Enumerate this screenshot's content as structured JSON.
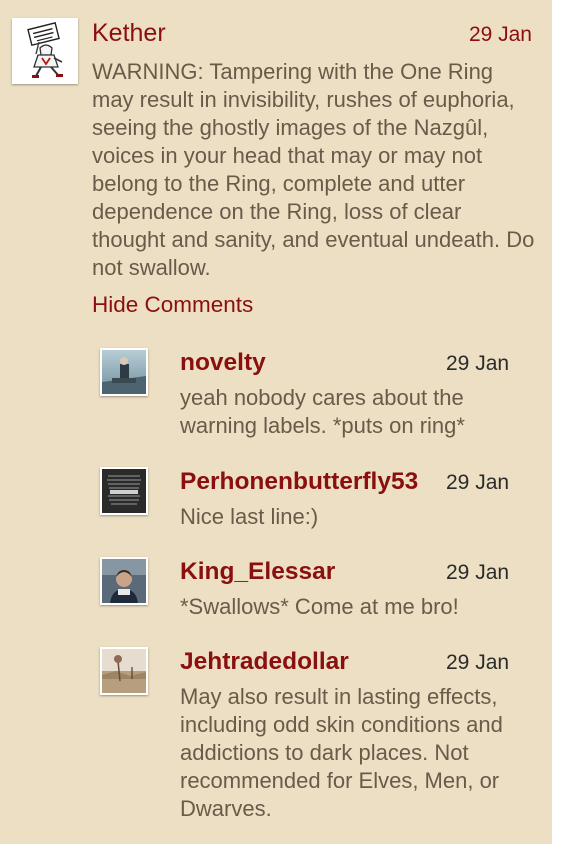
{
  "post": {
    "author": "Kether",
    "date": "29 Jan",
    "body": "WARNING: Tampering with the One Ring may result in invisibility, rushes of euphoria, seeing the ghostly images of the Nazgûl, voices in your head that may or may not belong to the Ring, complete and utter dependence on the Ring, loss of clear thought and sanity, and eventual undeath. Do not swallow.",
    "avatar_icon": "assassin-cartoon-avatar-icon",
    "hide_comments_label": "Hide Comments"
  },
  "replies": [
    {
      "author": "novelty",
      "date": "29 Jan",
      "body": "yeah nobody cares about the warning labels. *puts on ring*",
      "avatar_icon": "photo-avatar-icon"
    },
    {
      "author": "Perhonenbutterfly53",
      "date": "29 Jan",
      "body": "Nice last line:)",
      "avatar_icon": "text-poster-avatar-icon"
    },
    {
      "author": "King_Elessar",
      "date": "29 Jan",
      "body": "*Swallows* Come at me bro!",
      "avatar_icon": "portrait-avatar-icon"
    },
    {
      "author": "Jehtradedollar",
      "date": "29 Jan",
      "body": "May also result in lasting effects, including odd skin conditions and addictions to dark places. Not recommended for Elves, Men, or Dwarves.",
      "avatar_icon": "landscape-avatar-icon"
    }
  ],
  "colors": {
    "panel_background": "#eddfc3",
    "accent_red": "#8a0f0f",
    "body_text": "#6b5a4a",
    "date_text": "#2b2b2b"
  }
}
